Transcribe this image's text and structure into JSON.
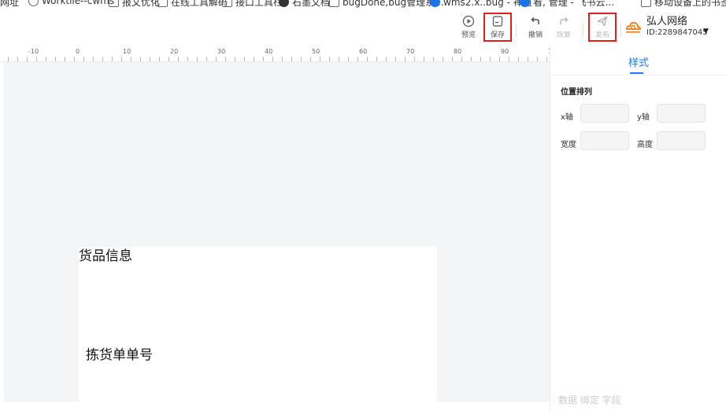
{
  "bookmarks": [
    {
      "label": "网址",
      "icon": "none"
    },
    {
      "label": "Worktile--cwms",
      "icon": "globe-icon"
    },
    {
      "label": "报文优化",
      "icon": "folder-icon"
    },
    {
      "label": "在线工具解码",
      "icon": "folder-icon"
    },
    {
      "label": "接口工具栏",
      "icon": "folder-icon"
    },
    {
      "label": "石墨文档",
      "icon": "dark-dot-icon"
    },
    {
      "label": "bugDone,bug管理系...",
      "icon": "logo-icon"
    },
    {
      "label": "wms2.x..bug - 禅道",
      "icon": "blue-dot-icon"
    },
    {
      "label": "看, 管理 - 飞书云...",
      "icon": "blue-dot-icon"
    },
    {
      "label": "移动设备上的书签",
      "icon": "folder-icon"
    }
  ],
  "toolbar": {
    "preview": "预览",
    "save": "保存",
    "undo": "撤销",
    "redo": "恢复",
    "publish": "发布"
  },
  "user": {
    "name": "弘人网络",
    "id": "ID:2289847045"
  },
  "ruler": {
    "labels": [
      "-10",
      "0",
      "10",
      "20",
      "30",
      "40",
      "50",
      "60",
      "70",
      "80",
      "90",
      "10"
    ]
  },
  "canvas": {
    "title": "货品信息",
    "field_label": "拣货单单号"
  },
  "panel": {
    "tab": "样式",
    "section": "位置排列",
    "x_label": "x轴",
    "y_label": "y轴",
    "width_label": "宽度",
    "height_label": "高度",
    "x_value": "",
    "y_value": "",
    "width_value": "",
    "height_value": "",
    "bottom_text": "数据 绑定 字段"
  },
  "colors": {
    "accent": "#1677ff",
    "highlight_box": "#e02020",
    "canvas_bg": "#f4f5f7"
  }
}
